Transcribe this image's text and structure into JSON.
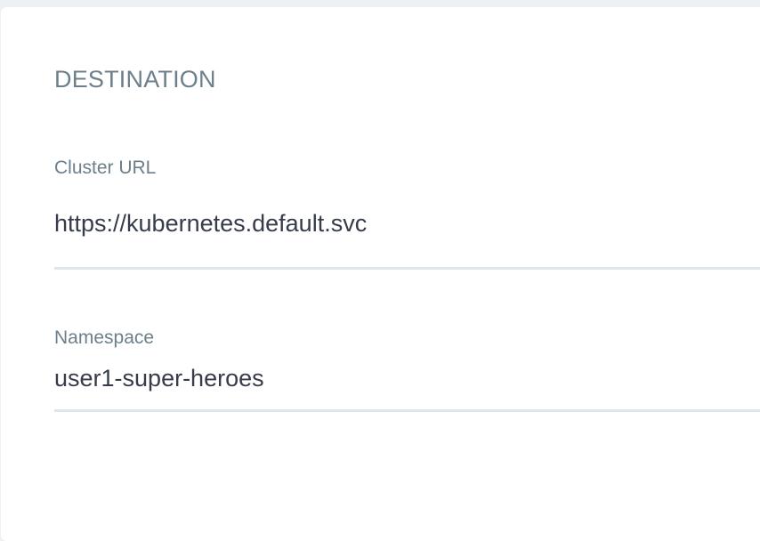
{
  "destination": {
    "title": "DESTINATION",
    "cluster_url": {
      "label": "Cluster URL",
      "value": "https://kubernetes.default.svc"
    },
    "namespace": {
      "label": "Namespace",
      "value": "user1-super-heroes"
    }
  }
}
